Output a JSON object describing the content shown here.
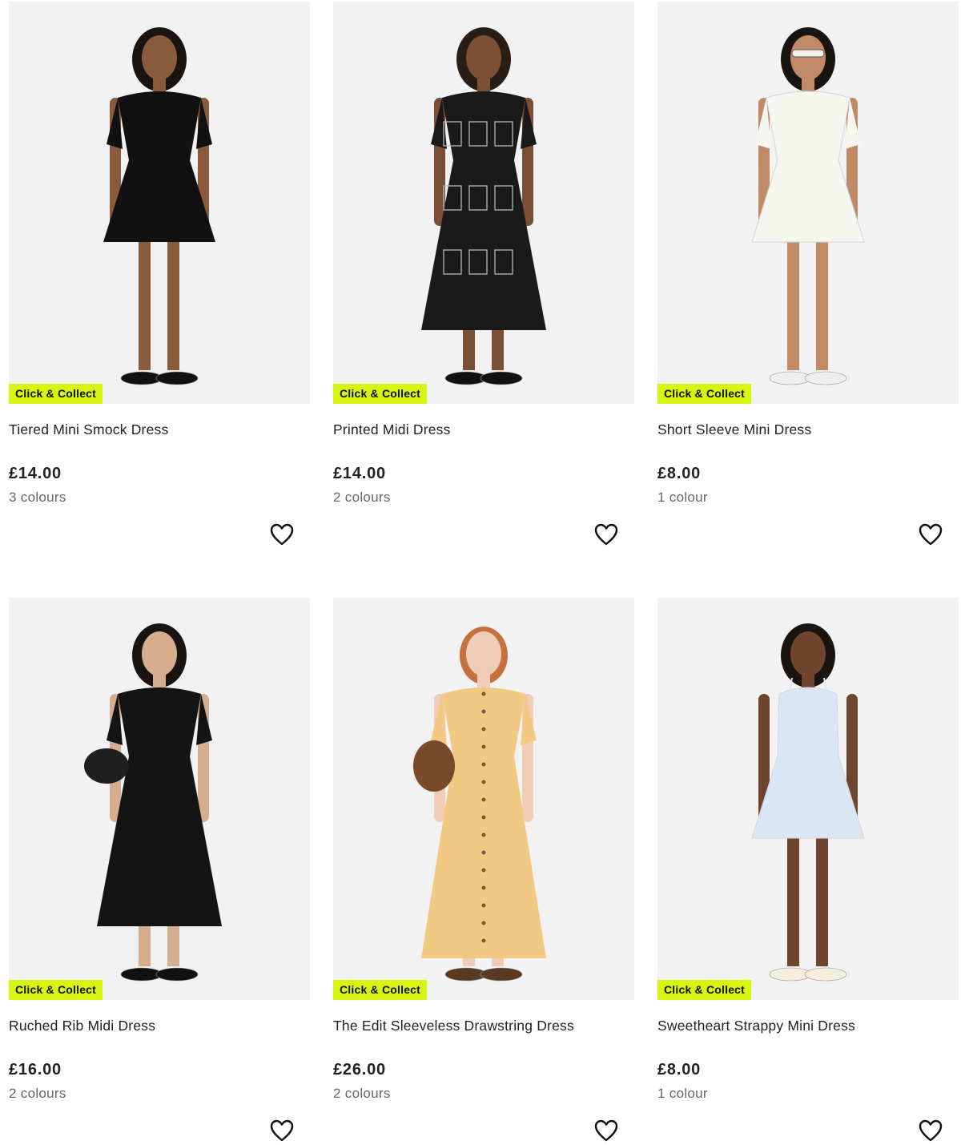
{
  "products": [
    {
      "badge": "Click & Collect",
      "title": "Tiered Mini Smock Dress",
      "price": "£14.00",
      "colours": "3 colours",
      "dress_color": "#111111",
      "skin": "#8a5a3c",
      "hair": "#1a1410",
      "shoes": "#111111",
      "icon": "heart-outline-icon"
    },
    {
      "badge": "Click & Collect",
      "title": "Printed Midi Dress",
      "price": "£14.00",
      "colours": "2 colours",
      "dress_color": "#1a1a1a",
      "skin": "#7a4f35",
      "hair": "#2a1d15",
      "shoes": "#111111",
      "icon": "heart-outline-icon"
    },
    {
      "badge": "Click & Collect",
      "title": "Short Sleeve Mini Dress",
      "price": "£8.00",
      "colours": "1 colour",
      "dress_color": "#f4f6ef",
      "skin": "#c08a66",
      "hair": "#1a1410",
      "shoes": "#eeeeee",
      "icon": "heart-outline-icon"
    },
    {
      "badge": "Click & Collect",
      "title": "Ruched Rib Midi Dress",
      "price": "£16.00",
      "colours": "2 colours",
      "dress_color": "#141414",
      "skin": "#d7ad8f",
      "hair": "#1a1410",
      "shoes": "#111111",
      "icon": "heart-outline-icon"
    },
    {
      "badge": "Click & Collect",
      "title": "The Edit Sleeveless Drawstring Dress",
      "price": "£26.00",
      "colours": "2 colours",
      "dress_color": "#f2c982",
      "skin": "#efcdb6",
      "hair": "#c4703f",
      "shoes": "#5a3a24",
      "icon": "heart-outline-icon"
    },
    {
      "badge": "Click & Collect",
      "title": "Sweetheart Strappy Mini Dress",
      "price": "£8.00",
      "colours": "1 colour",
      "dress_color": "#dbe6f5",
      "skin": "#6f4530",
      "hair": "#1a1410",
      "shoes": "#f3eedd",
      "icon": "heart-outline-icon"
    }
  ],
  "colors": {
    "badge_bg": "#d6f510",
    "image_bg": "#f2f2f2",
    "text": "#222222",
    "muted": "#666666"
  }
}
